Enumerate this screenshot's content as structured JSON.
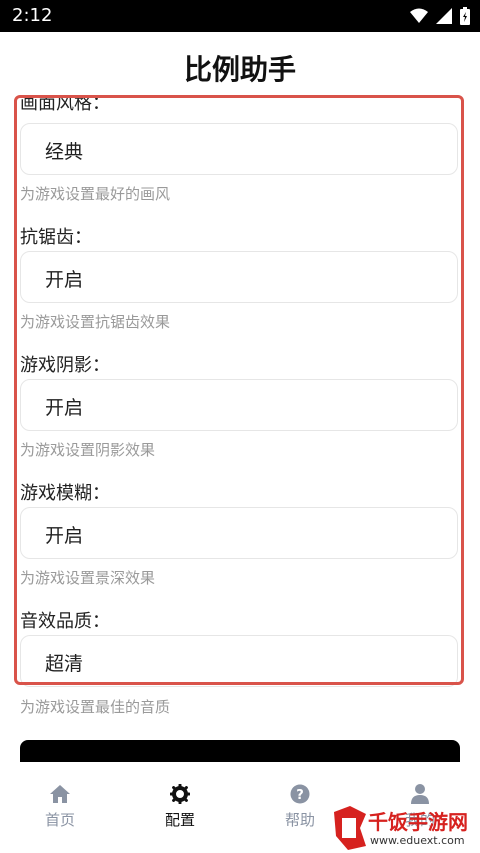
{
  "status_bar": {
    "time": "2:12"
  },
  "page": {
    "title": "比例助手"
  },
  "settings": [
    {
      "label": "画面风格：",
      "value": "经典",
      "hint": "为游戏设置最好的画风"
    },
    {
      "label": "抗锯齿：",
      "value": "开启",
      "hint": "为游戏设置抗锯齿效果"
    },
    {
      "label": "游戏阴影：",
      "value": "开启",
      "hint": "为游戏设置阴影效果"
    },
    {
      "label": "游戏模糊：",
      "value": "开启",
      "hint": "为游戏设置景深效果"
    },
    {
      "label": "音效品质：",
      "value": "超清",
      "hint": "为游戏设置最佳的音质"
    }
  ],
  "bottom_nav": [
    {
      "label": "首页",
      "icon": "home-icon",
      "active": false
    },
    {
      "label": "配置",
      "icon": "gear-icon",
      "active": true
    },
    {
      "label": "帮助",
      "icon": "help-icon",
      "active": false
    },
    {
      "label": "我的",
      "icon": "user-icon",
      "active": false
    }
  ],
  "watermark": {
    "text": "千饭手游网",
    "url": "www.eduext.com"
  },
  "colors": {
    "highlight": "#d9534a",
    "nav_inactive": "#8a93a3",
    "nav_active": "#111111"
  }
}
